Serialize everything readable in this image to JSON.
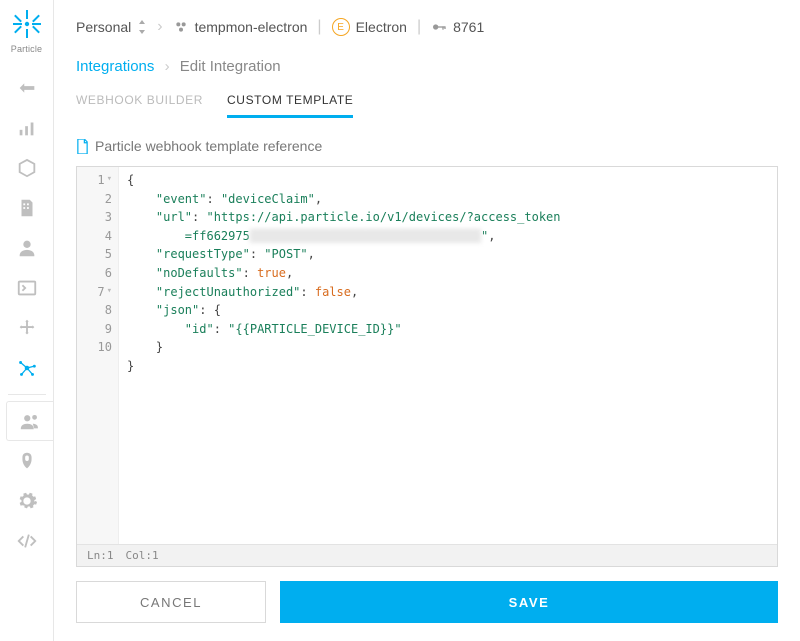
{
  "brand": "Particle",
  "topbar": {
    "scope": "Personal",
    "device": "tempmon-electron",
    "platform": "Electron",
    "platform_badge": "E",
    "device_code": "8761"
  },
  "breadcrumb": {
    "integrations": "Integrations",
    "current": "Edit Integration"
  },
  "tabs": {
    "builder": "Webhook Builder",
    "custom": "Custom Template"
  },
  "reference_link": "Particle webhook template reference",
  "editor": {
    "line_numbers": [
      "1",
      "2",
      "3",
      "4",
      "5",
      "6",
      "7",
      "8",
      "9",
      "10"
    ],
    "fold_lines": [
      1,
      7
    ],
    "json_content": {
      "event": "deviceClaim",
      "url_prefix": "https://api.particle.io/v1/devices/?access_token",
      "url_token_visible": "=ff662975",
      "url_token_redacted": "████████████████████████████████",
      "requestType": "POST",
      "noDefaults": true,
      "rejectUnauthorized": false,
      "json_id": "{{PARTICLE_DEVICE_ID}}"
    },
    "status": {
      "ln_label": "Ln:",
      "ln": "1",
      "col_label": "Col:",
      "col": "1"
    }
  },
  "actions": {
    "cancel": "Cancel",
    "save": "Save"
  }
}
